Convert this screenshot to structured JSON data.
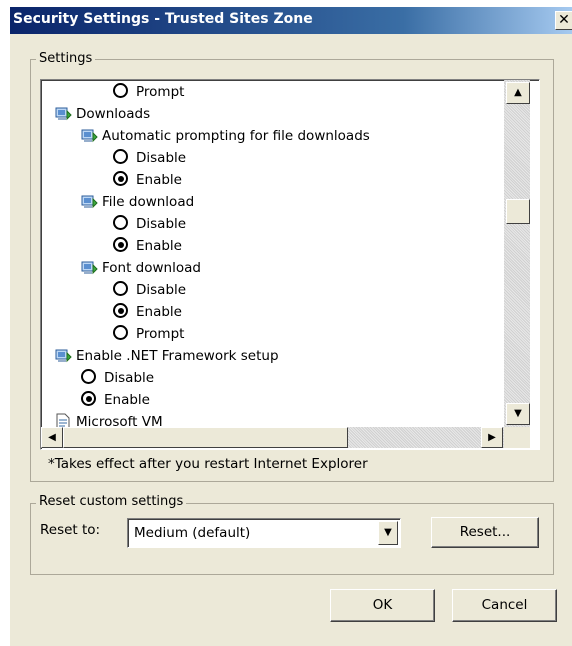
{
  "window": {
    "title": "Security Settings - Trusted Sites Zone",
    "close_glyph": "✕"
  },
  "settings_group": {
    "label": "Settings"
  },
  "tree": [
    {
      "kind": "radio",
      "label": "Prompt",
      "checked": false,
      "level": 2
    },
    {
      "kind": "folder",
      "label": "Downloads",
      "level": 0
    },
    {
      "kind": "folder",
      "label": "Automatic prompting for file downloads",
      "level": 1
    },
    {
      "kind": "radio",
      "label": "Disable",
      "checked": false,
      "level": 2
    },
    {
      "kind": "radio",
      "label": "Enable",
      "checked": true,
      "level": 2
    },
    {
      "kind": "folder",
      "label": "File download",
      "level": 1
    },
    {
      "kind": "radio",
      "label": "Disable",
      "checked": false,
      "level": 2
    },
    {
      "kind": "radio",
      "label": "Enable",
      "checked": true,
      "level": 2
    },
    {
      "kind": "folder",
      "label": "Font download",
      "level": 1
    },
    {
      "kind": "radio",
      "label": "Disable",
      "checked": false,
      "level": 2
    },
    {
      "kind": "radio",
      "label": "Enable",
      "checked": true,
      "level": 2
    },
    {
      "kind": "radio",
      "label": "Prompt",
      "checked": false,
      "level": 2
    },
    {
      "kind": "folder",
      "label": "Enable .NET Framework setup",
      "level": 0
    },
    {
      "kind": "radio",
      "label": "Disable",
      "checked": false,
      "level": 1
    },
    {
      "kind": "radio",
      "label": "Enable",
      "checked": true,
      "level": 1
    },
    {
      "kind": "page",
      "label": "Microsoft VM",
      "level": 0
    }
  ],
  "restart_note": "*Takes effect after you restart Internet Explorer",
  "reset_group": {
    "label": "Reset custom settings",
    "reset_to_label": "Reset to:",
    "selected": "Medium (default)",
    "reset_button": "Reset..."
  },
  "footer": {
    "ok": "OK",
    "cancel": "Cancel"
  },
  "icons": {
    "scroll_up": "▲",
    "scroll_down": "▼",
    "scroll_left": "◀",
    "scroll_right": "▶",
    "dropdown": "▼"
  },
  "colors": {
    "title_start": "#0a246a",
    "title_end": "#a6caf0",
    "dialog_bg": "#ece9d8"
  }
}
